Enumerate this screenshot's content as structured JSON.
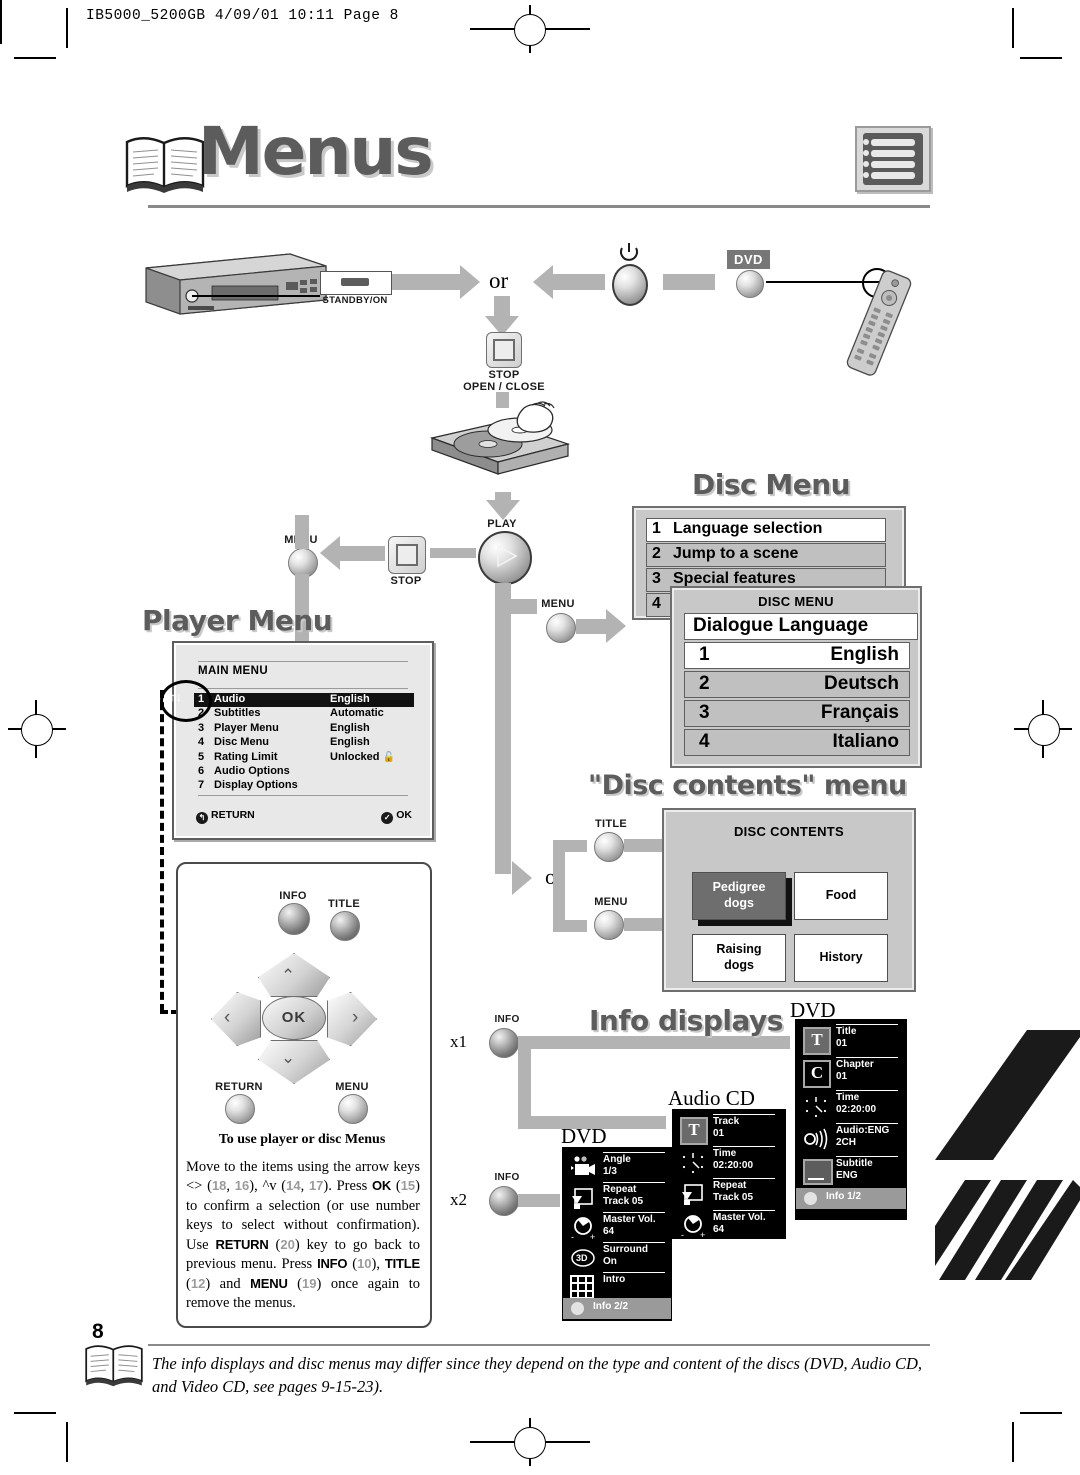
{
  "header": {
    "slug": "IB5000_5200GB  4/09/01 10:11  Page 8"
  },
  "title": {
    "text": "Menus",
    "book_icon": "open-book-icon",
    "corner_icon": "menu-list-icon"
  },
  "flow": {
    "standby_label": "STANDBY/ON",
    "or_1": "or",
    "power_icon": "power-icon",
    "dvd_badge": "DVD",
    "stop_open_close": "STOP\nOPEN / CLOSE",
    "stop_label_1": "STOP",
    "stop_label_2": "OPEN / CLOSE",
    "play_label": "PLAY",
    "stop_label": "STOP",
    "menu_label_left": "MENU",
    "menu_label_mid": "MENU",
    "title_label": "TITLE",
    "menu_label_dc": "MENU",
    "or_2": "or",
    "info_label_x1": "INFO",
    "info_label_x2": "INFO",
    "x1": "x1",
    "x2": "x2"
  },
  "player_menu": {
    "heading": "Player Menu",
    "panel_title": "MAIN MENU",
    "rows": [
      {
        "num": "1",
        "label": "Audio",
        "value": "English",
        "selected": true
      },
      {
        "num": "2",
        "label": "Subtitles",
        "value": "Automatic",
        "selected": false
      },
      {
        "num": "3",
        "label": "Player Menu",
        "value": "English",
        "selected": false
      },
      {
        "num": "4",
        "label": "Disc Menu",
        "value": "English",
        "selected": false
      },
      {
        "num": "5",
        "label": "Rating Limit",
        "value": "Unlocked",
        "selected": false,
        "icon": "open-padlock-icon"
      },
      {
        "num": "6",
        "label": "Audio Options",
        "value": "",
        "selected": false
      },
      {
        "num": "7",
        "label": "Display Options",
        "value": "",
        "selected": false
      }
    ],
    "footer_return": "RETURN",
    "footer_ok": "OK",
    "updown_icon": "up-down-arrows-icon"
  },
  "nav": {
    "info": "INFO",
    "title": "TITLE",
    "ok": "OK",
    "return": "RETURN",
    "menu": "MENU",
    "heading": "To use player or disc Menus",
    "body_html": "Move to the items using the arrow keys &lt;&gt; (<span class=\"num\">18</span>, <span class=\"num\">16</span>), ^v (<span class=\"num\">14</span>, <span class=\"num\">17</span>). Press <b>OK</b> (<span class=\"num\">15</span>) to confirm a selection (or use number keys to select without confirmation). Use <b>RETURN</b> (<span class=\"num\">20</span>) key to go back to previous menu. Press <b>INFO</b> (<span class=\"num\">10</span>), <b>TITLE</b> (<span class=\"num\">12</span>) and <b>MENU</b> (<span class=\"num\">19</span>) once again to remove the menus."
  },
  "disc_menu": {
    "heading": "Disc Menu",
    "rows": [
      {
        "num": "1",
        "label": "Language selection",
        "highlighted": true
      },
      {
        "num": "2",
        "label": "Jump to a scene",
        "highlighted": false
      },
      {
        "num": "3",
        "label": "Special features",
        "highlighted": false
      },
      {
        "num": "4",
        "label": "",
        "highlighted": false
      }
    ]
  },
  "dialogue_panel": {
    "panel_title": "DISC MENU",
    "header_row": "Dialogue Language",
    "rows": [
      {
        "num": "1",
        "label": "English",
        "highlighted": true
      },
      {
        "num": "2",
        "label": "Deutsch",
        "highlighted": false
      },
      {
        "num": "3",
        "label": "Français",
        "highlighted": false
      },
      {
        "num": "4",
        "label": "Italiano",
        "highlighted": false
      }
    ]
  },
  "disc_contents": {
    "heading": "\"Disc contents\" menu",
    "panel_title": "DISC CONTENTS",
    "cells": [
      {
        "line1": "Pedigree",
        "line2": "dogs",
        "selected": true
      },
      {
        "line1": "Food",
        "line2": "",
        "selected": false
      },
      {
        "line1": "Raising",
        "line2": "dogs",
        "selected": false
      },
      {
        "line1": "History",
        "line2": "",
        "selected": false
      }
    ]
  },
  "info_displays": {
    "heading": "Info displays",
    "dvd_1": {
      "caption": "DVD",
      "rows": [
        {
          "icon": "title-t-icon",
          "line1": "Title",
          "line2": "01"
        },
        {
          "icon": "chapter-c-icon",
          "line1": "Chapter",
          "line2": "01"
        },
        {
          "icon": "clock-icon",
          "line1": "Time",
          "line2": "02:20:00"
        },
        {
          "icon": "speaker-icon",
          "line1": "Audio:ENG",
          "line2": "2CH"
        },
        {
          "icon": "subtitle-icon",
          "line1": "Subtitle",
          "line2": "ENG"
        }
      ],
      "footer": "Info 1/2"
    },
    "audio_cd": {
      "caption": "Audio CD",
      "rows": [
        {
          "icon": "track-t-icon",
          "line1": "Track",
          "line2": "01"
        },
        {
          "icon": "clock-icon",
          "line1": "Time",
          "line2": "02:20:00"
        },
        {
          "icon": "repeat-icon",
          "line1": "Repeat",
          "line2": "Track 05"
        },
        {
          "icon": "volume-icon",
          "line1": "Master Vol.",
          "line2": "64"
        }
      ]
    },
    "dvd_2": {
      "caption": "DVD",
      "rows": [
        {
          "icon": "camera-angle-icon",
          "line1": "Angle",
          "line2": "1/3"
        },
        {
          "icon": "repeat-icon",
          "line1": "Repeat",
          "line2": "Track 05"
        },
        {
          "icon": "volume-icon",
          "line1": "Master Vol.",
          "line2": "64"
        },
        {
          "icon": "surround-3d-icon",
          "line1": "Surround",
          "line2": "On"
        },
        {
          "icon": "intro-grid-icon",
          "line1": "Intro",
          "line2": ""
        }
      ],
      "footer": "Info 2/2"
    }
  },
  "footer": {
    "page_number": "8",
    "note": "The info displays and disc menus may differ since they depend on the type and content of the discs (DVD, Audio CD, and Video CD, see pages 9-15-23).",
    "book_icon": "open-book-icon"
  },
  "colors": {
    "grey_arrow": "#b3b3b3",
    "osd_grey": "#c8c8c8",
    "title_grey": "#5c5c5c",
    "osd_black": "#000000"
  }
}
